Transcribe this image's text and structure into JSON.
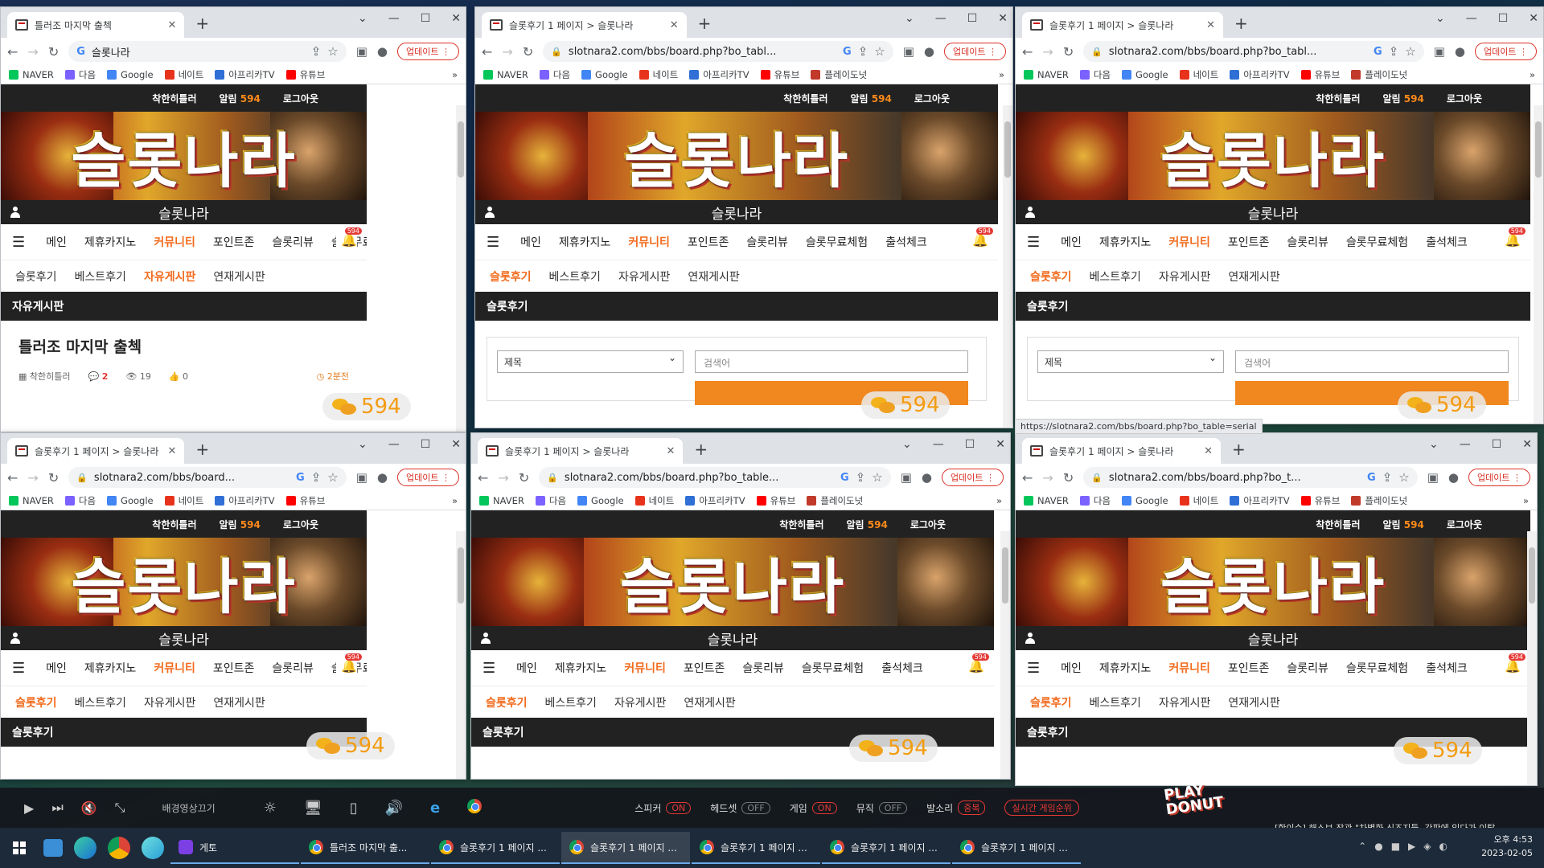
{
  "windows": [
    {
      "tab_title": "틀러조 마지막 출첵",
      "url": "슬롯나라",
      "kind": "post",
      "subnav_active": 2,
      "section": "자유게시판",
      "url_has_lock": false
    },
    {
      "tab_title": "슬롯후기 1 페이지 > 슬롯나라",
      "url": "slotnara2.com/bbs/board.php?bo_tabl...",
      "kind": "list",
      "subnav_active": 0,
      "section": "슬롯후기",
      "url_has_lock": true
    },
    {
      "tab_title": "슬롯후기 1 페이지 > 슬롯나라",
      "url": "slotnara2.com/bbs/board.php?bo_tabl...",
      "kind": "list",
      "subnav_active": 0,
      "section": "슬롯후기",
      "url_has_lock": true
    },
    {
      "tab_title": "슬롯후기 1 페이지 > 슬롯나라",
      "url": "slotnara2.com/bbs/board...",
      "kind": "short",
      "subnav_active": 0,
      "section": "슬롯후기",
      "url_has_lock": true
    },
    {
      "tab_title": "슬롯후기 1 페이지 > 슬롯나라",
      "url": "slotnara2.com/bbs/board.php?bo_table...",
      "kind": "short",
      "subnav_active": 0,
      "section": "슬롯후기",
      "url_has_lock": true
    },
    {
      "tab_title": "슬롯후기 1 페이지 > 슬롯나라",
      "url": "slotnara2.com/bbs/board.php?bo_t...",
      "kind": "short",
      "subnav_active": 0,
      "section": "슬롯후기",
      "url_has_lock": true
    }
  ],
  "browser": {
    "update_label": "업데이트",
    "bookmarks": [
      "NAVER",
      "다음",
      "Google",
      "네이트",
      "아프리카TV",
      "유튜브",
      "플레이도넛"
    ],
    "bookmark_colors": [
      "#03c75a",
      "#7b61ff",
      "#4285f4",
      "#e8331c",
      "#2f6fd6",
      "#ff0000",
      "#c0392b"
    ]
  },
  "site": {
    "topbar": {
      "user": "착한히틀러",
      "alarm_label": "알림",
      "alarm_count": "594",
      "logout": "로그아웃"
    },
    "banner_text": "슬롯나라",
    "username": "슬롯나라",
    "main_nav": [
      "메인",
      "제휴카지노",
      "커뮤니티",
      "포인트존",
      "슬롯리뷰",
      "슬롯무료체험",
      "출석체크"
    ],
    "main_nav_active": 2,
    "bell_badge": "594",
    "sub_nav": [
      "슬롯후기",
      "베스트후기",
      "자유게시판",
      "연재게시판"
    ],
    "float_count": "594"
  },
  "post": {
    "title": "틀러조 마지막 출첵",
    "author": "착한히틀러",
    "comments": "2",
    "views": "19",
    "likes": "0",
    "time": "2분전"
  },
  "search": {
    "select_label": "제목",
    "keyword_placeholder": "검색어"
  },
  "status_url": "https://slotnara2.com/bbs/board.php?bo_table=serial",
  "media_bar": {
    "title": "배경영상끄기",
    "toggles": [
      {
        "label": "스피커",
        "state": "ON",
        "on": true
      },
      {
        "label": "헤드셋",
        "state": "OFF",
        "on": false
      },
      {
        "label": "게임",
        "state": "ON",
        "on": true
      },
      {
        "label": "뮤직",
        "state": "OFF",
        "on": false
      },
      {
        "label": "발소리",
        "state": "중복",
        "on": true
      }
    ],
    "ranking": "실시간 게임순위",
    "logo": "PLAY DONUT",
    "ticker": "[핫이슈] 해스브 장관 \"차별화 신조지들, 간판에 있다가 이탈..."
  },
  "taskbar": {
    "apps": [
      {
        "label": "게토",
        "chrome": false
      },
      {
        "label": "틀러조 마지막 출...",
        "chrome": true
      },
      {
        "label": "슬롯후기 1 페이지 ...",
        "chrome": true
      },
      {
        "label": "슬롯후기 1 페이지 ...",
        "chrome": true
      },
      {
        "label": "슬롯후기 1 페이지 ...",
        "chrome": true
      },
      {
        "label": "슬롯후기 1 페이지 ...",
        "chrome": true
      },
      {
        "label": "슬롯후기 1 페이지 ...",
        "chrome": true
      }
    ],
    "time": "오후 4:53",
    "date": "2023-02-05"
  }
}
